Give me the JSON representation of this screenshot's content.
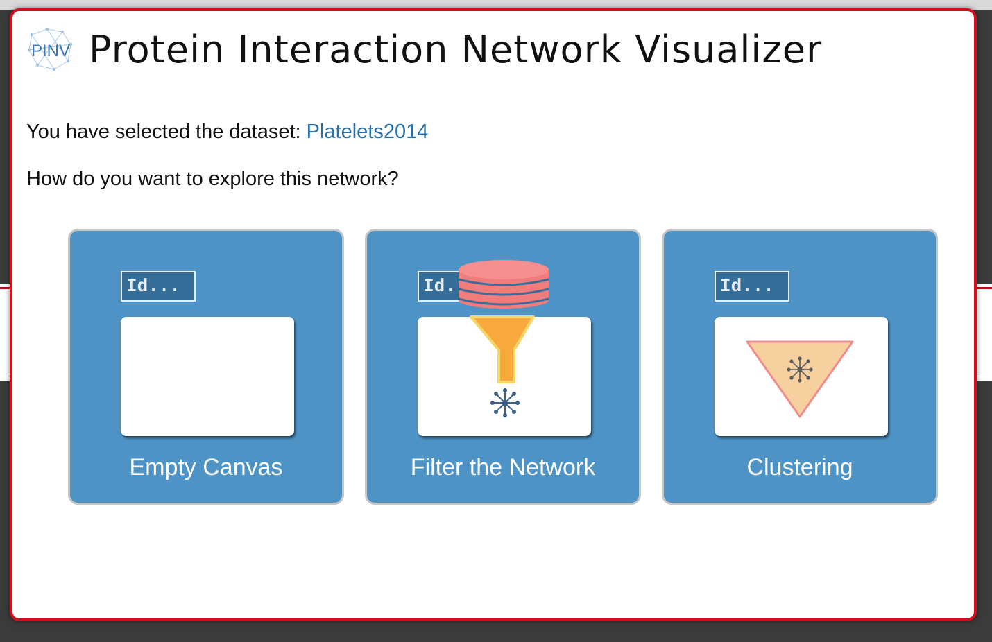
{
  "app": {
    "logo_text": "PINV",
    "title": "Protein Interaction Network Visualizer"
  },
  "intro": {
    "dataset_prefix": "You have selected the dataset:",
    "dataset_name": "Platelets2014",
    "question": "How do you want to explore this network?"
  },
  "options": [
    {
      "id_placeholder": "Id...",
      "label": "Empty Canvas",
      "icon": "empty-canvas-icon"
    },
    {
      "id_placeholder": "Id...",
      "label": "Filter the Network",
      "icon": "database-funnel-icon"
    },
    {
      "id_placeholder": "Id...",
      "label": "Clustering",
      "icon": "cluster-triangle-icon"
    }
  ],
  "colors": {
    "modal_border": "#d0101c",
    "card_bg": "#4e93c5",
    "link": "#2a6fa8",
    "database": "#f07c7c",
    "funnel": "#f7a93b",
    "triangle_fill": "#f7d0a0",
    "triangle_stroke": "#ef8c8c",
    "network_node": "#3d5f8a"
  }
}
